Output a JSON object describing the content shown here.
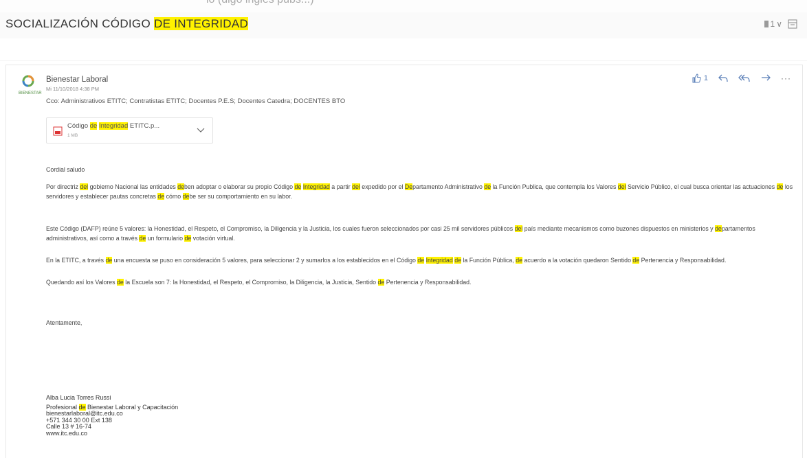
{
  "top_strip_text": "lo (digo ingles pubs...)",
  "subject": {
    "prefix": "SOCIALIZACIÓN CÓDIGO ",
    "highlight": "DE INTEGRIDAD",
    "count": "1",
    "chevron": "∨"
  },
  "message": {
    "sender": "Bienestar Laboral",
    "avatar_caption": "BIENESTAR",
    "date": "Mi 11/10/2018 4:38 PM",
    "cco": "Cco: Administrativos ETITC; Contratistas ETITC; Docentes P.E.S; Docentes Catedra; DOCENTES BTO",
    "like_count": "1",
    "more": "···",
    "attachment": {
      "name_prefix": "Código ",
      "name_hl1": "de",
      "name_hl2": "Integridad",
      "name_suffix": " ETITC.p...",
      "size": "1 MB"
    },
    "greeting": "Cordial saludo",
    "p1": [
      {
        "t": "Por directriz "
      },
      {
        "t": "del",
        "h": true
      },
      {
        "t": " gobierno Nacional las entidades "
      },
      {
        "t": "de",
        "h": true
      },
      {
        "t": "ben adoptar o elaborar su propio Código "
      },
      {
        "t": "de",
        "h": true
      },
      {
        "t": " "
      },
      {
        "t": "Integridad",
        "h": true
      },
      {
        "t": " a partir "
      },
      {
        "t": "del",
        "h": true
      },
      {
        "t": " expedido por el "
      },
      {
        "t": "De",
        "h": true
      },
      {
        "t": "partamento Administrativo "
      },
      {
        "t": "de",
        "h": true
      },
      {
        "t": " la Función Publica, que contempla los Valores "
      },
      {
        "t": "del",
        "h": true
      },
      {
        "t": " Servicio Público, el cual busca orientar las actuaciones "
      },
      {
        "t": "de",
        "h": true
      },
      {
        "t": " los servidores y establecer pautas concretas "
      },
      {
        "t": "de",
        "h": true
      },
      {
        "t": " cómo "
      },
      {
        "t": "de",
        "h": true
      },
      {
        "t": "be ser su comportamiento en su labor."
      }
    ],
    "p2": [
      {
        "t": "Este Código (DAFP) reúne 5 valores: la Honestidad, el Respeto, el Compromiso, la Diligencia y la Justicia, los cuales fueron seleccionados por casi 25 mil servidores públicos "
      },
      {
        "t": "del",
        "h": true
      },
      {
        "t": " país mediante mecanismos como buzones dispuestos en ministerios y "
      },
      {
        "t": "de",
        "h": true
      },
      {
        "t": "partamentos administrativos, así como a través "
      },
      {
        "t": "de",
        "h": true
      },
      {
        "t": " un formulario "
      },
      {
        "t": "de",
        "h": true
      },
      {
        "t": " votación virtual."
      }
    ],
    "p3": [
      {
        "t": "En la ETITC, a través "
      },
      {
        "t": "de",
        "h": true
      },
      {
        "t": " una encuesta se puso en consideración 5 valores, para seleccionar 2 y sumarlos a los establecidos en el Código "
      },
      {
        "t": "de",
        "h": true
      },
      {
        "t": " "
      },
      {
        "t": "Integridad",
        "h": true
      },
      {
        "t": " "
      },
      {
        "t": "de",
        "h": true
      },
      {
        "t": " la Función Pública,  "
      },
      {
        "t": "de",
        "h": true
      },
      {
        "t": " acuerdo a la votación quedaron Sentido "
      },
      {
        "t": "de",
        "h": true
      },
      {
        "t": " Pertenencia y Responsabilidad."
      }
    ],
    "p4": [
      {
        "t": "Quedando así los Valores "
      },
      {
        "t": "de",
        "h": true
      },
      {
        "t": " la Escuela son 7: la Honestidad, el Respeto, el Compromiso, la Diligencia, la Justicia, Sentido "
      },
      {
        "t": "de",
        "h": true
      },
      {
        "t": " Pertenencia y Responsabilidad."
      }
    ],
    "closing": "Atentamente,",
    "signature": {
      "name": "Alba Lucia Torres Russi",
      "title_prefix": "Profesional ",
      "title_hl": "de",
      "title_suffix": " Bienestar Laboral y Capacitación",
      "email": "bienestarlaboral@itc.edu.co",
      "phone": "+571 344 30 00 Ext 138",
      "address": "Calle 13 # 16-74",
      "web": "www.itc.edu.co"
    }
  },
  "colors": {
    "highlight": "#fff200",
    "action_blue": "#5a7fb8"
  }
}
